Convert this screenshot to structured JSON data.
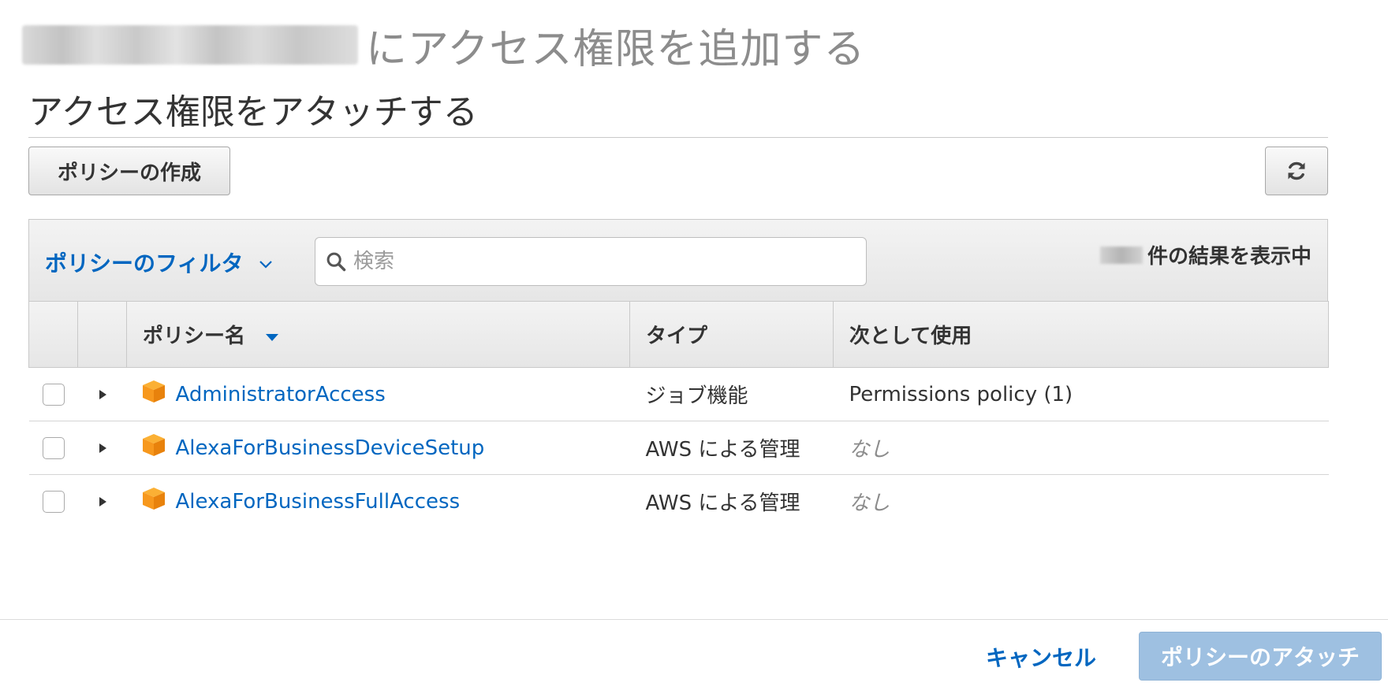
{
  "header": {
    "title_suffix": "にアクセス権限を追加する",
    "section_title": "アクセス権限をアタッチする"
  },
  "toolbar": {
    "create_policy_label": "ポリシーの作成",
    "refresh_icon": "refresh-icon"
  },
  "filter": {
    "label": "ポリシーのフィルタ",
    "search_placeholder": "検索",
    "search_value": "",
    "result_count_suffix": "件の結果を表示中"
  },
  "table": {
    "columns": {
      "name": "ポリシー名",
      "type": "タイプ",
      "used_as": "次として使用"
    },
    "sort": {
      "column": "name",
      "direction": "descending"
    },
    "rows": [
      {
        "name": "AdministratorAccess",
        "type": "ジョブ機能",
        "used_as": "Permissions policy (1)",
        "checked": false
      },
      {
        "name": "AlexaForBusinessDeviceSetup",
        "type": "AWS による管理",
        "used_as": "なし",
        "checked": false
      },
      {
        "name": "AlexaForBusinessFullAccess",
        "type": "AWS による管理",
        "used_as": "なし",
        "checked": false
      }
    ]
  },
  "footer": {
    "cancel_label": "キャンセル",
    "attach_label": "ポリシーのアタッチ"
  },
  "colors": {
    "link": "#0066c0",
    "policy_icon": "#f7981d",
    "primary_disabled": "#9ec0e1",
    "title_gray": "#8c8c8c"
  }
}
